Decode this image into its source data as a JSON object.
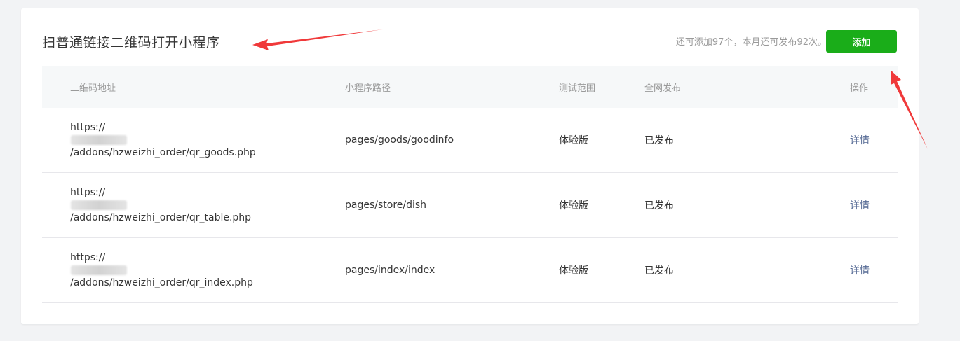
{
  "header": {
    "title": "扫普通链接二维码打开小程序",
    "quota_text": "还可添加97个，本月还可发布92次。",
    "add_button": "添加"
  },
  "table": {
    "columns": [
      "二维码地址",
      "小程序路径",
      "测试范围",
      "全网发布",
      "操作"
    ],
    "rows": [
      {
        "qr_prefix": "https://",
        "qr_suffix": "/addons/hzweizhi_order/qr_goods.php",
        "path": "pages/goods/goodinfo",
        "test_scope": "体验版",
        "publish": "已发布",
        "action": "详情"
      },
      {
        "qr_prefix": "https://",
        "qr_suffix": "/addons/hzweizhi_order/qr_table.php",
        "path": "pages/store/dish",
        "test_scope": "体验版",
        "publish": "已发布",
        "action": "详情"
      },
      {
        "qr_prefix": "https://",
        "qr_suffix": "/addons/hzweizhi_order/qr_index.php",
        "path": "pages/index/index",
        "test_scope": "体验版",
        "publish": "已发布",
        "action": "详情"
      }
    ]
  },
  "colors": {
    "accent_green": "#1aad19",
    "link_blue": "#576b95",
    "annotation_red": "#f0393a"
  }
}
